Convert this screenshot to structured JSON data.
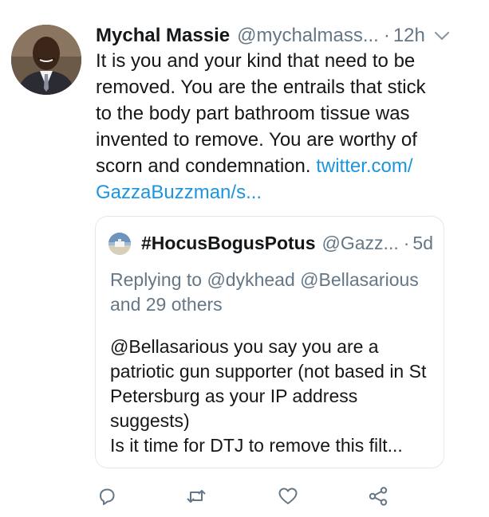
{
  "tweet": {
    "author_name": "Mychal Massie",
    "author_handle": "@mychalmass...",
    "separator": "·",
    "time": "12h",
    "text": "It is you and your kind that need to be removed. You are the entrails that stick to the body part bathroom tissue was invented to remove.  You are worthy of scorn and condemnation. ",
    "link_text": "twitter.com/\nGazzaBuzzman/s...",
    "icons": {
      "avatar": "profile-photo",
      "more": "chevron-down-icon"
    }
  },
  "quoted_tweet": {
    "author_name": "#HocusBogusPotus",
    "author_handle": "@Gazz...",
    "separator": "·",
    "time": "5d",
    "replying_to": "Replying to @dykhead @Bellasarious and 29 others",
    "text": "@Bellasarious you say you are a patriotic gun supporter (not based in St Petersburg as your IP address suggests)\nIs it time for DTJ to  remove this filt..."
  },
  "actions": [
    {
      "name": "reply-icon"
    },
    {
      "name": "retweet-icon"
    },
    {
      "name": "like-icon"
    },
    {
      "name": "share-icon"
    }
  ],
  "colors": {
    "link": "#1b95e0",
    "secondary_text": "#657786",
    "border": "#e1e8ed"
  }
}
